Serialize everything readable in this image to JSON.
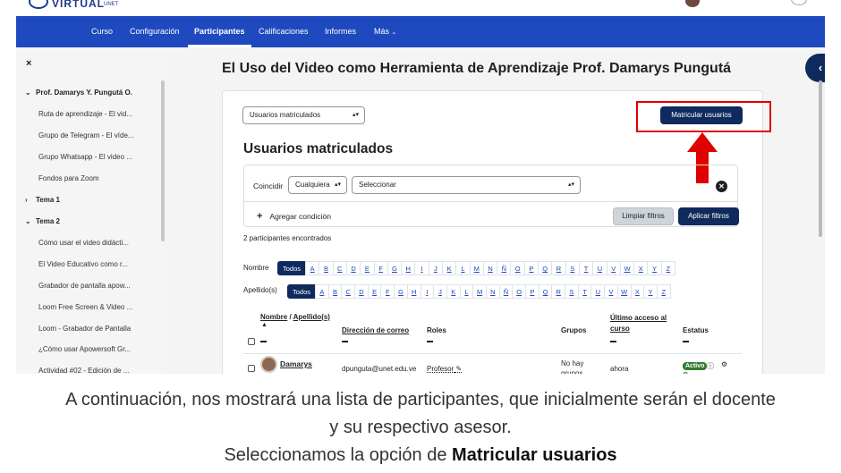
{
  "brand": {
    "logo_text": "VIRTUAL",
    "logo_sub": "UNET"
  },
  "nav": {
    "items": [
      {
        "label": "Curso",
        "active": false
      },
      {
        "label": "Configuración",
        "active": false
      },
      {
        "label": "Participantes",
        "active": true
      },
      {
        "label": "Calificaciones",
        "active": false
      },
      {
        "label": "Informes",
        "active": false
      },
      {
        "label": "Más",
        "active": false
      }
    ],
    "more_chevron": "chevron-down-icon"
  },
  "drawer": {
    "close_icon": "×",
    "items": [
      {
        "label": "Prof. Damarys Y. Pungutá O.",
        "kind": "section",
        "expanded": true
      },
      {
        "label": "Ruta de aprendizaje - El vid...",
        "kind": "link"
      },
      {
        "label": "Grupo de Telegram - El víde...",
        "kind": "link"
      },
      {
        "label": "Grupo Whatsapp - El video ...",
        "kind": "link"
      },
      {
        "label": "Fondos para Zoom",
        "kind": "link"
      },
      {
        "label": "Tema 1",
        "kind": "section",
        "expanded": false
      },
      {
        "label": "Tema 2",
        "kind": "section",
        "expanded": true
      },
      {
        "label": "Cómo usar el video didácti...",
        "kind": "link"
      },
      {
        "label": "El Video Educativo como r...",
        "kind": "link"
      },
      {
        "label": "Grabador de pantalla apow...",
        "kind": "link"
      },
      {
        "label": "Loom Free Screen & Video ...",
        "kind": "link"
      },
      {
        "label": "Loom - Grabador de Pantalla",
        "kind": "link"
      },
      {
        "label": "¿Cómo usar Apowersoft Gr...",
        "kind": "link"
      },
      {
        "label": "Actividad #02 - Edición de ...",
        "kind": "link"
      }
    ]
  },
  "page": {
    "title": "El Uso del Video como Herramienta de Aprendizaje Prof. Damarys Pungutá",
    "view_select": "Usuarios matriculados",
    "enrol_button": "Matricular usuarios",
    "section_title": "Usuarios matriculados"
  },
  "filters": {
    "match_label": "Coincidir",
    "match_value": "Cualquiera",
    "select_placeholder": "Seleccionar",
    "add_condition": "Agregar condición",
    "clear_button": "Limpiar filtros",
    "apply_button": "Aplicar filtros"
  },
  "participants_count": "2 participantes encontrados",
  "initials": {
    "first_label": "Nombre",
    "last_label": "Apellido(s)",
    "all_label": "Todos",
    "letters": [
      "A",
      "B",
      "C",
      "D",
      "E",
      "F",
      "G",
      "H",
      "I",
      "J",
      "K",
      "L",
      "M",
      "N",
      "Ñ",
      "O",
      "P",
      "Q",
      "R",
      "S",
      "T",
      "U",
      "V",
      "W",
      "X",
      "Y",
      "Z"
    ]
  },
  "table": {
    "headers": {
      "name_first": "Nombre",
      "name_sep": "/",
      "name_last": "Apellido(s)",
      "email": "Dirección de correo",
      "roles": "Roles",
      "groups": "Grupos",
      "last_access_1": "Último acceso al",
      "last_access_2": "curso",
      "status": "Estatus"
    },
    "rows": [
      {
        "name": "Damarys",
        "email": "dpunguta@unet.edu.ve",
        "role": "Profesor",
        "groups_1": "No hay",
        "groups_2": "grupos",
        "last_access": "ahora",
        "status": "Activo"
      }
    ]
  },
  "caption": {
    "line1": "A continuación, nos mostrará una lista de participantes, que inicialmente serán el docente",
    "line2": "y su respectivo asesor.",
    "line3_prefix": "Seleccionamos la opción de ",
    "line3_bold": "Matricular usuarios"
  }
}
